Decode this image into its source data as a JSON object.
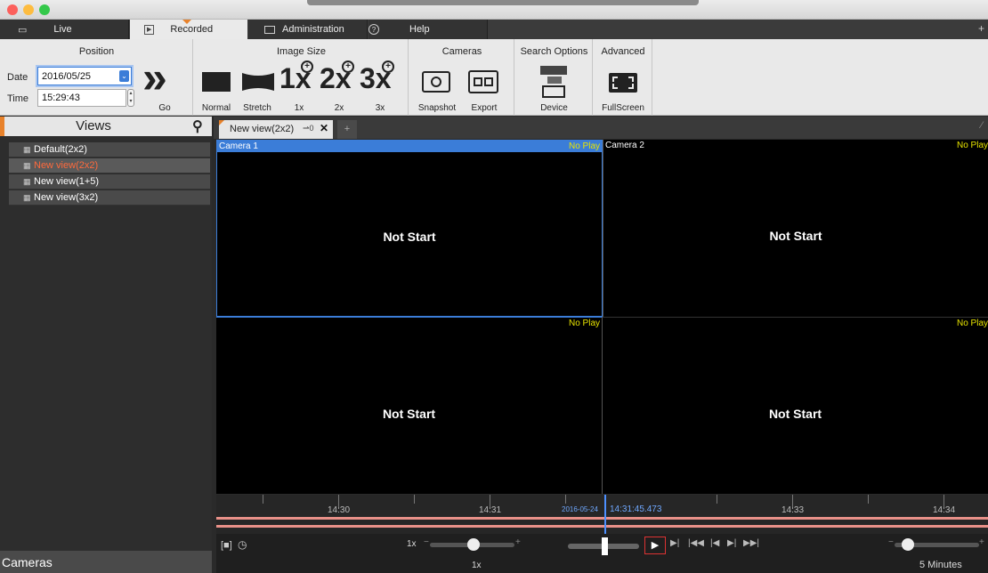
{
  "tabs": {
    "live": "Live",
    "recorded": "Recorded",
    "administration": "Administration",
    "help": "Help"
  },
  "ribbon": {
    "position": {
      "title": "Position",
      "date_label": "Date",
      "date_value": "2016/05/25",
      "time_label": "Time",
      "time_value": "15:29:43",
      "go_label": "Go"
    },
    "image_size": {
      "title": "Image Size",
      "normal": "Normal",
      "stretch": "Stretch",
      "zoom_1x": "1x",
      "zoom_2x": "2x",
      "zoom_3x": "3x",
      "big_1x": "1x",
      "big_2x": "2x",
      "big_3x": "3x"
    },
    "cameras": {
      "title": "Cameras",
      "snapshot": "Snapshot",
      "export": "Export"
    },
    "search_options": {
      "title": "Search Options",
      "device": "Device"
    },
    "advanced": {
      "title": "Advanced",
      "fullscreen": "FullScreen"
    }
  },
  "sidebar": {
    "title": "Views",
    "items": [
      {
        "label": "Default(2x2)"
      },
      {
        "label": "New view(2x2)"
      },
      {
        "label": "New view(1+5)"
      },
      {
        "label": "New view(3x2)"
      }
    ],
    "footer": "Cameras"
  },
  "content": {
    "view_tab": "New view(2x2)",
    "view_tab_counter": "0",
    "add_tab": "+",
    "cells": [
      {
        "camera": "Camera 1",
        "status": "No Play",
        "message": "Not Start"
      },
      {
        "camera": "Camera 2",
        "status": "No Play",
        "message": "Not Start"
      },
      {
        "camera": "",
        "status": "No Play",
        "message": "Not Start"
      },
      {
        "camera": "",
        "status": "No Play",
        "message": "Not Start"
      }
    ]
  },
  "timeline": {
    "ticks": [
      "14:30",
      "14:31",
      "14:33",
      "14:34"
    ],
    "cursor_date": "2016-05-24",
    "cursor_time": "14:31:45.473"
  },
  "controls": {
    "speed_label": "1x",
    "speed_value": "1x",
    "zoom_label": "5 Minutes"
  },
  "colors": {
    "accent": "#e8822b",
    "selection": "#3b7dd8",
    "status": "#e8e400",
    "selected_view_text": "#ff6a3d"
  }
}
